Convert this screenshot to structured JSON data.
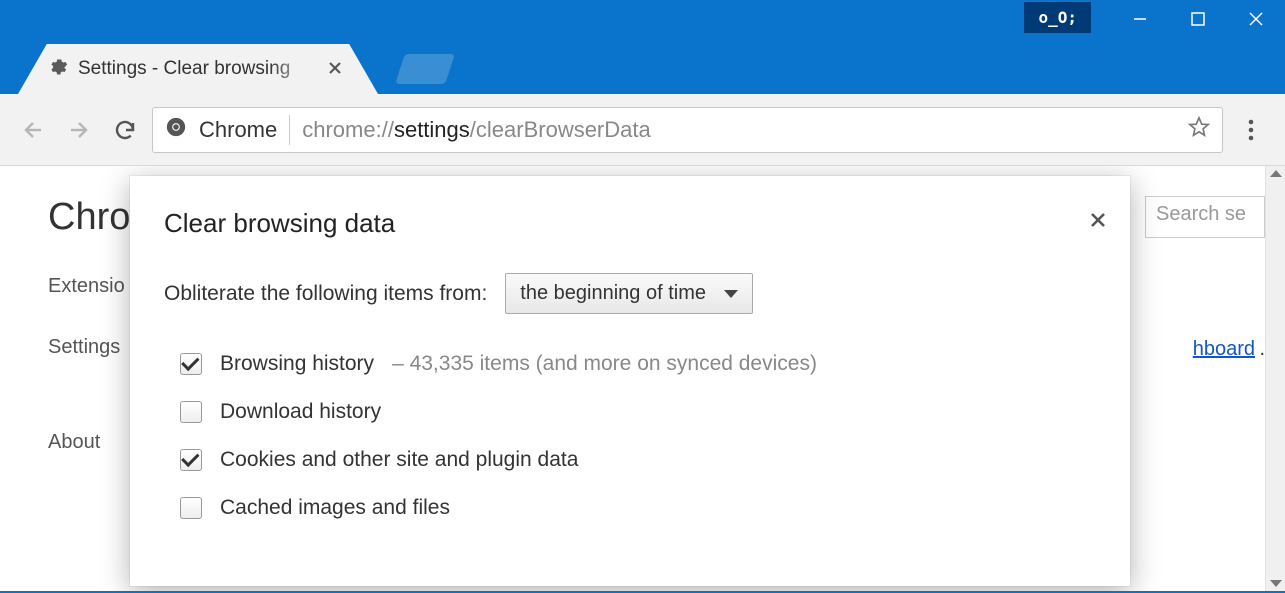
{
  "window": {
    "extension_badge": "o_O;"
  },
  "tab": {
    "title": "Settings - Clear browsing"
  },
  "omnibox": {
    "scheme_label": "Chrome",
    "url_prefix": "chrome://",
    "url_bold": "settings",
    "url_suffix": "/clearBrowserData"
  },
  "background": {
    "heading": "Chro",
    "sidebar": [
      {
        "label": "Extensio"
      },
      {
        "label": "Settings"
      },
      {
        "label": "About"
      }
    ],
    "search_placeholder": "Search se",
    "partial_link": "hboard",
    "partial_link_suffix": "."
  },
  "dialog": {
    "title": "Clear browsing data",
    "obliterate_label": "Obliterate the following items from:",
    "time_range": "the beginning of time",
    "options": [
      {
        "label": "Browsing history",
        "detail": "–  43,335 items (and more on synced devices)",
        "checked": true
      },
      {
        "label": "Download history",
        "detail": "",
        "checked": false
      },
      {
        "label": "Cookies and other site and plugin data",
        "detail": "",
        "checked": true
      },
      {
        "label": "Cached images and files",
        "detail": "",
        "checked": false
      }
    ]
  }
}
